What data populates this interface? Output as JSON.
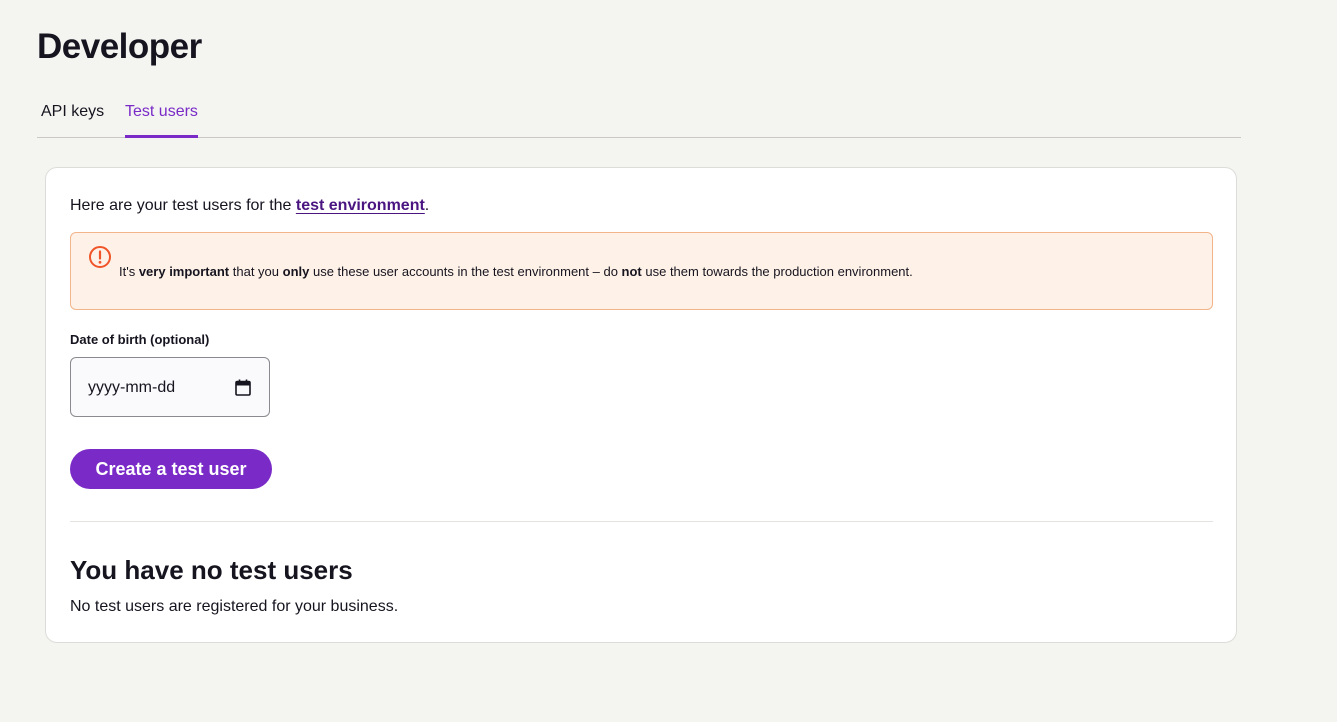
{
  "page": {
    "title": "Developer"
  },
  "tabs": [
    {
      "label": "API keys",
      "active": false
    },
    {
      "label": "Test users",
      "active": true
    }
  ],
  "intro": {
    "prefix": "Here are your test users for the ",
    "link_text": "test environment",
    "suffix": "."
  },
  "warning": {
    "icon": "exclamation-circle-icon",
    "parts": [
      {
        "text": "It's ",
        "bold": false
      },
      {
        "text": "very important",
        "bold": true
      },
      {
        "text": " that you ",
        "bold": false
      },
      {
        "text": "only",
        "bold": true
      },
      {
        "text": " use these user accounts in the test environment – do ",
        "bold": false
      },
      {
        "text": "not",
        "bold": true
      },
      {
        "text": " use them towards the production environment.",
        "bold": false
      }
    ]
  },
  "form": {
    "dob_label": "Date of birth (optional)",
    "dob_placeholder": "yyyy-mm-dd",
    "calendar_icon": "calendar-icon",
    "create_button": "Create a test user"
  },
  "empty_state": {
    "title": "You have no test users",
    "description": "No test users are registered for your business."
  },
  "colors": {
    "accent": "#7a2bc7",
    "background": "#f4f4f1",
    "warning_bg": "#fef2e8",
    "warning_border": "#f2b48a",
    "warning_icon": "#f0552a"
  }
}
